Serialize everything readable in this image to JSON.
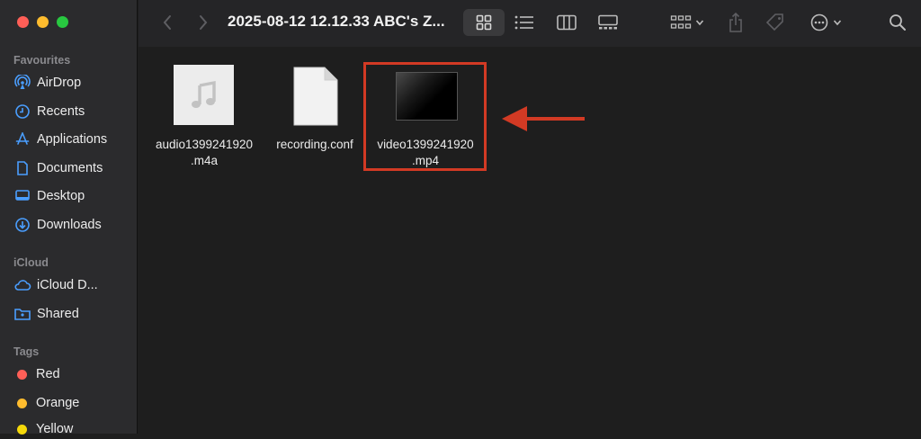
{
  "window": {
    "title": "2025-08-12 12.12.33 ABC's Z...",
    "traffic_lights": {
      "close": "#ff5f57",
      "minimize": "#febc2e",
      "zoom": "#28c840"
    }
  },
  "sidebar": {
    "sections": [
      {
        "title": "Favourites",
        "items": [
          {
            "label": "AirDrop",
            "icon": "airdrop-icon"
          },
          {
            "label": "Recents",
            "icon": "clock-icon"
          },
          {
            "label": "Applications",
            "icon": "applications-icon"
          },
          {
            "label": "Documents",
            "icon": "document-icon"
          },
          {
            "label": "Desktop",
            "icon": "desktop-icon"
          },
          {
            "label": "Downloads",
            "icon": "download-icon"
          }
        ]
      },
      {
        "title": "iCloud",
        "items": [
          {
            "label": "iCloud D...",
            "icon": "cloud-icon"
          },
          {
            "label": "Shared",
            "icon": "shared-folder-icon"
          }
        ]
      },
      {
        "title": "Tags",
        "items": [
          {
            "label": "Red",
            "color": "#ff5f57"
          },
          {
            "label": "Orange",
            "color": "#febc2e"
          },
          {
            "label": "Yellow",
            "color": "#f5d90a"
          }
        ]
      }
    ],
    "accent": "#4a9eff"
  },
  "files": [
    {
      "line1": "audio1399241920",
      "line2": ".m4a",
      "icon": "music-file-icon"
    },
    {
      "line1": "recording.conf",
      "line2": "",
      "icon": "blank-file-icon"
    },
    {
      "line1": "video1399241920",
      "line2": ".mp4",
      "icon": "video-thumbnail-icon"
    }
  ],
  "annotation": {
    "color": "#d23a24"
  }
}
